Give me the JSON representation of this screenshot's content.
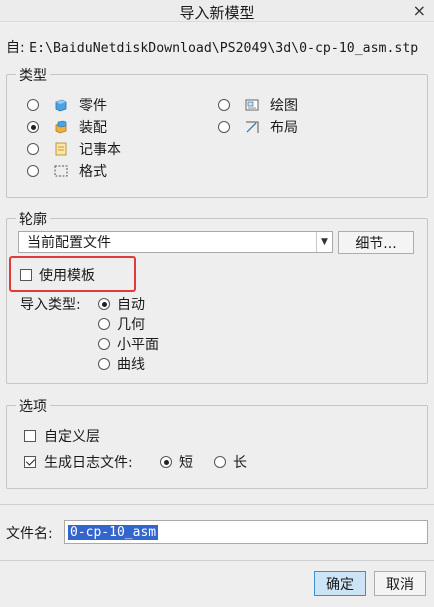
{
  "window": {
    "title": "导入新模型",
    "close_glyph": "×"
  },
  "from": {
    "label": "自:",
    "path": "E:\\BaiduNetdiskDownload\\PS2049\\3d\\0-cp-10_asm.stp"
  },
  "type_group": {
    "legend": "类型",
    "options": [
      {
        "label": "零件",
        "icon": "part-icon",
        "selected": false
      },
      {
        "label": "装配",
        "icon": "assembly-icon",
        "selected": true
      },
      {
        "label": "记事本",
        "icon": "notebook-icon",
        "selected": false
      },
      {
        "label": "格式",
        "icon": "format-icon",
        "selected": false
      },
      {
        "label": "绘图",
        "icon": "drawing-icon",
        "selected": false
      },
      {
        "label": "布局",
        "icon": "layout-icon",
        "selected": false
      }
    ]
  },
  "profile_group": {
    "legend": "轮廓",
    "dropdown_value": "当前配置文件",
    "details_button": "细节...",
    "use_template_label": "使用模板",
    "use_template_checked": false,
    "import_type_label": "导入类型:",
    "import_types": [
      {
        "label": "自动",
        "selected": true
      },
      {
        "label": "几何",
        "selected": false
      },
      {
        "label": "小平面",
        "selected": false
      },
      {
        "label": "曲线",
        "selected": false
      }
    ]
  },
  "options_group": {
    "legend": "选项",
    "custom_layer_label": "自定义层",
    "custom_layer_checked": false,
    "log_label": "生成日志文件:",
    "log_checked": true,
    "log_short": "短",
    "log_long": "长",
    "log_selected": "短"
  },
  "filename": {
    "label": "文件名:",
    "value": "0-cp-10_asm"
  },
  "buttons": {
    "ok": "确定",
    "cancel": "取消"
  },
  "colors": {
    "highlight_box": "#e03a3a",
    "selection": "#3366cc",
    "primary_button": "#cde4f7"
  }
}
